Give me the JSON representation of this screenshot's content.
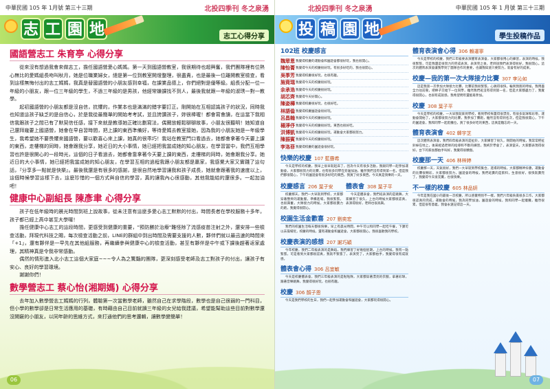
{
  "left": {
    "running_header": {
      "issue": "中華民國 105 年 1月號 第三十三期",
      "zine": "北投四季刊 冬之泉湧"
    },
    "banner": {
      "title_chars": [
        "志",
        "工",
        "園",
        "地"
      ],
      "tag": "志工心得分享"
    },
    "articles": [
      {
        "heading": "國語營志工 朱育亭 心得分享",
        "paragraphs": [
          "從來沒有想過我會來做志工，擔任國語營愛心媽媽。第一天到國語營教室，我很期待也超興奮，我們團隊裡有位熱心無比的愛媽組長吻叫秋月，她是位職業婦女，總是第一位到教室開燈整理，很盡責，也是最後一位離開教室檢查，看到這樣無悔付出的志工媽媽，我真是替國語營的小朋友感到幸福，在課業品德上，你們絕對是優等級。組長分配一位一年級的小朋友，跟一位三年級的學生，不過三年級的是男孩，他經常嫌課找不到人，最後我就跟一年級的淑琇一對一教學。",
          "起初國語營的小朋友都是沒自信，抗懼的，作業本也是滿滿的錯字要訂正。剛開始在互相認識孩子的狀況，同時我也知道這孩子缺乏的是自信心，於是我從最簡單的開始考考試，並且誇讚孩子，妳很棒喔！都會寫會讀，在這當下我相信我跟孩子之間已有了默契信任感，接下來就是教導她正確比劃寫法，偶爾放輕鬆聊聊故事，小朋友很聽明！她知道自己還拜幾要上國語營，她會在早自習時間，把上課的東西準備好，等待愛媽去教室接她，因為我的小朋友她是一年級學生，我希望她不要畏懼來國語營，要以歡喜心來上課，她真的很乖巧！我站在教室門口看過去，她都會拿著今天要上課的東西，走樓梯的同時，她會跟我分享，她近日的大小事情，她已經把我當成她的知心朋友，在學習當中，我們互相學習也許是很開心的一段時光，這個的日子看過去，她都會靠拿著今天要上課的東西，走樓梯的同時，她會跟我分享。她近日的大小事情，她已經把我當成她的知心朋友，在學習互相的過程我跟小朋友都是贏家，我感覺大家又實踐了這句話，『分享多一點就是快樂』。最後我還是有很多的感謝，是很自然地學習讓我和孩子成長，她就會跟著我的速度以上，這個時候學習這樣下去，這麼珍惜的一個方式與自信的學習，真的讓我內心很感動，其他我能給的還很多。一起加油吧！"
        ]
      },
      {
        "heading": "健康中心副組長 陳彥聿 心得分享",
        "paragraphs": [
          "孩子在低年級時的晨光時間到班上說故事，從未注意有這麼多愛心志工默默的付出，時間長者在學校服務十多年，孩子都已經上高中甚至大學囉！",
          "擔任健康中心志工的這段時間，更感受到健康的重要，\"預防勝於治療\"難怪除了流感疫苗注射之外，還安排一些檢查活動，拜現代科技之賜，每次檢查活動之前，LINE的群組中到出時間及需要支援的人數，夥伴們就以最迅速的時間來「+1」，還有夥伴是一早先在其他組服務，再繼續參與健康中心的檢查活動，甚至有夥伴是中午或下課後趕著返家處理，其精神真是令我非常感動。",
          "偶然的情形進入北小志工這個大家庭~~~令人為之驚豔的團隊，更深刻感受老師及志工對孩子的付出，讓孩子有安心、良好的學習環境。",
          "謝謝你們！"
        ]
      },
      {
        "heading": "數學營志工 蔡心怡(湘期媽) 心得分享",
        "paragraphs": [
          "去年加入數學營志工媽媽的行列，體驗第一次當數學老師，雖然自己在求學階段，數學也是自己很弱的一門科目，但小學的數學卻是日常生活應用的基礎，有時藉由自己目前就讀三年級的女兒給我建議，希望能幫助這些目前對數學還沒開竅的小朋友，以同年齡的思維方式，來打通他們的思考邏輯，讓數學變簡單！"
        ]
      }
    ],
    "page_number": "06"
  },
  "right": {
    "running_header": {
      "zine": "北投四季刊 冬之泉湧",
      "issue": "中華民國 105 年 1 月號 第三十三期"
    },
    "banner": {
      "title_chars": [
        "投",
        "稿",
        "園",
        "地"
      ],
      "tag": "學生投稿作品"
    },
    "col1": {
      "heading": "102班 校慶感言",
      "entries": [
        {
          "name": "魏眾恩",
          "text": "我覺得校慶的運動會和園遊會都很好玩，我也很開心。"
        },
        {
          "name": "陳怡菁",
          "text": "我覺得今天的校慶很好玩，有很多好吃的，我也很開心。"
        },
        {
          "name": "吳季芳",
          "text": "我覺得校慶很好玩，也很有趣。"
        },
        {
          "name": "施竟瑞",
          "text": "我覺得今天的校慶很好玩。"
        },
        {
          "name": "余承浩",
          "text": "我覺得今天的校慶很好玩。"
        },
        {
          "name": "胡芯齊",
          "text": "我覺得今天好開心。"
        },
        {
          "name": "陳姿樺",
          "text": "我覺得校慶很好玩，也很好吃。"
        },
        {
          "name": "林語倫",
          "text": "我覺得校慶園遊會很好玩。"
        },
        {
          "name": "呂昌翰",
          "text": "我覺得今天的校慶很好玩。"
        },
        {
          "name": "楊淨伃",
          "text": "我覺得今天的校慶很好玩，東西也很好吃。"
        },
        {
          "name": "洪博凱",
          "text": "我覺得今天的校慶很好玩，運動會大家都很努力。"
        },
        {
          "name": "陳振賓",
          "text": "我覺得今天的校慶很好玩。"
        },
        {
          "name": "李洛菲",
          "text": "我覺得校慶的園遊會很好玩。"
        }
      ],
      "blocks": [
        {
          "title": "快樂的校慶",
          "by": "107 藍霽希",
          "text": "今天是學校的校慶，我早上很早就起床了，因為今天有很多活動，我跟同學一起參加運動會，大家都很努力的比賽，也有很多同學在旁邊加油，雖然我們沒有得到第一名，但是我們都很開心，下午的園遊會有很多好吃的東西，我買了好多東西，今天真是快樂的一天。"
        },
        {
          "title": "校慶感言",
          "by": "206 葉子安",
          "text": "校慶那天，我們一大早就到學校，大家都穿著整齊的運動服，準備進場，我很緊張，也很興奮，大隊接力的時候，大家都很賣力的跑，我覺得很開心。"
        },
        {
          "title": "體表會",
          "by": "308 葉子平",
          "text": "今天是體表會，我們班表演的是跳舞，大家練習了很久，上台的時候大家都很認真，表演得很好，老師也很高興。"
        },
        {
          "title": "校園生活金歡喜",
          "by": "207 劉奕宏",
          "text": "我們的校園生活每天都很快樂，早上有晨光時間，中午可以和同學一起吃午餐，下課可以去操場玩，校慶的時候，還有運動會和園遊會，大家都很開心，我很喜歡我的學校。"
        },
        {
          "title": "校慶表演的感想",
          "by": "207 謝巧穎",
          "text": "今年校慶，我們二年級表演的是舞蹈，我們練習了好幾個星期，上台的時候，我有一點緊張，可是看到大家都很認真，我就不緊張了，表演完了，大家都拍手，我覺得很有成就感。"
        },
        {
          "title": "體表會心得",
          "by": "306 呂宜敏",
          "text": "今天是校慶體表會，我們三年級表演的是啦啦隊，大家都穿著漂亮的衣服，拿著彩球，跟著音樂跳舞，我覺得很好玩，也很有趣。"
        },
        {
          "title": "校慶",
          "by": "306 顏子恩",
          "text": "今天是我們學校的生日，我們一起參加運動會和園遊會，大家都玩得很開心。"
        }
      ]
    },
    "col2": {
      "blocks": [
        {
          "title": "體育表演會心得",
          "by": "306 賴運寧",
          "text": "今天是學校的校慶，我們三年級要表演體育表演會，大家都很用心的練習，表演的時候，我很緊張，可是我還是很努力的完成表演，表演完之後，老師說我們表演得很好，我很開心。這次的體育表演會讓我學到了團隊合作的重要，也讓我知道只要努力，就會有好的成果。"
        },
        {
          "title": "校慶—我的第一次大隊接力比賽",
          "by": "307 李沁如",
          "text": "這是我第一次參加大隊接力比賽，比賽前我很緊張，心跳得很快，輪到我跑的時候，我用盡全力往前衝，把棒子交給下一位同學，雖然我們班沒有得到第一名，但是大家都盡力了，我覺得很開心，也很有成就感，我希望明年還能再參加。"
        },
        {
          "title": "校慶",
          "by": "308 葉子平",
          "text": "今天是學校的校慶，一大早我就來到學校，看到學校佈置得很漂亮，有很多氣球和彩帶，運動會開始了，大家都很努力的比賽，我參加了賽跑，雖然沒有得到名次，但是我很開心，下午的園遊會，我和同學一起逛攤位，買了很多好吃的東西，這真是難忘的一天。"
        },
        {
          "title": "體育表演會",
          "by": "402 韓宇芝",
          "text": "這次體育表演會，我們四年級表演的是扯鈴，大家練習了很久，剛開始的時候，我常常把扯鈴掉在地上，後來經過老師的指導和不斷的練習，我終於學會了，表演當天，大家都表現得很好，台下的家長都拍手叫好，我覺得很驕傲。"
        },
        {
          "title": "校慶那一天",
          "by": "406 林梓婷",
          "text": "校慶那一天，天氣很好，我們一大早就到學校集合，進場的時候，大家都精神抖擻，運動會的比賽很精彩，大家都很努力，園遊會的時候，我們班賣的是飲料，生意很好，很快就賣完了，我覺得今天很充實，也很快樂。"
        },
        {
          "title": "不一樣的校慶",
          "by": "605 林品妍",
          "text": "今年是我在國小的最後一次校慶，所以感覺特別不一樣，我們六年級負責很多工作，大家都很認真的完成，運動會的時候，我為同學加油，園遊會的時候，我和同學一起擺攤，雖然很累，但是很有意義，我會永遠記得這一天。"
        }
      ]
    },
    "page_number": "07"
  }
}
